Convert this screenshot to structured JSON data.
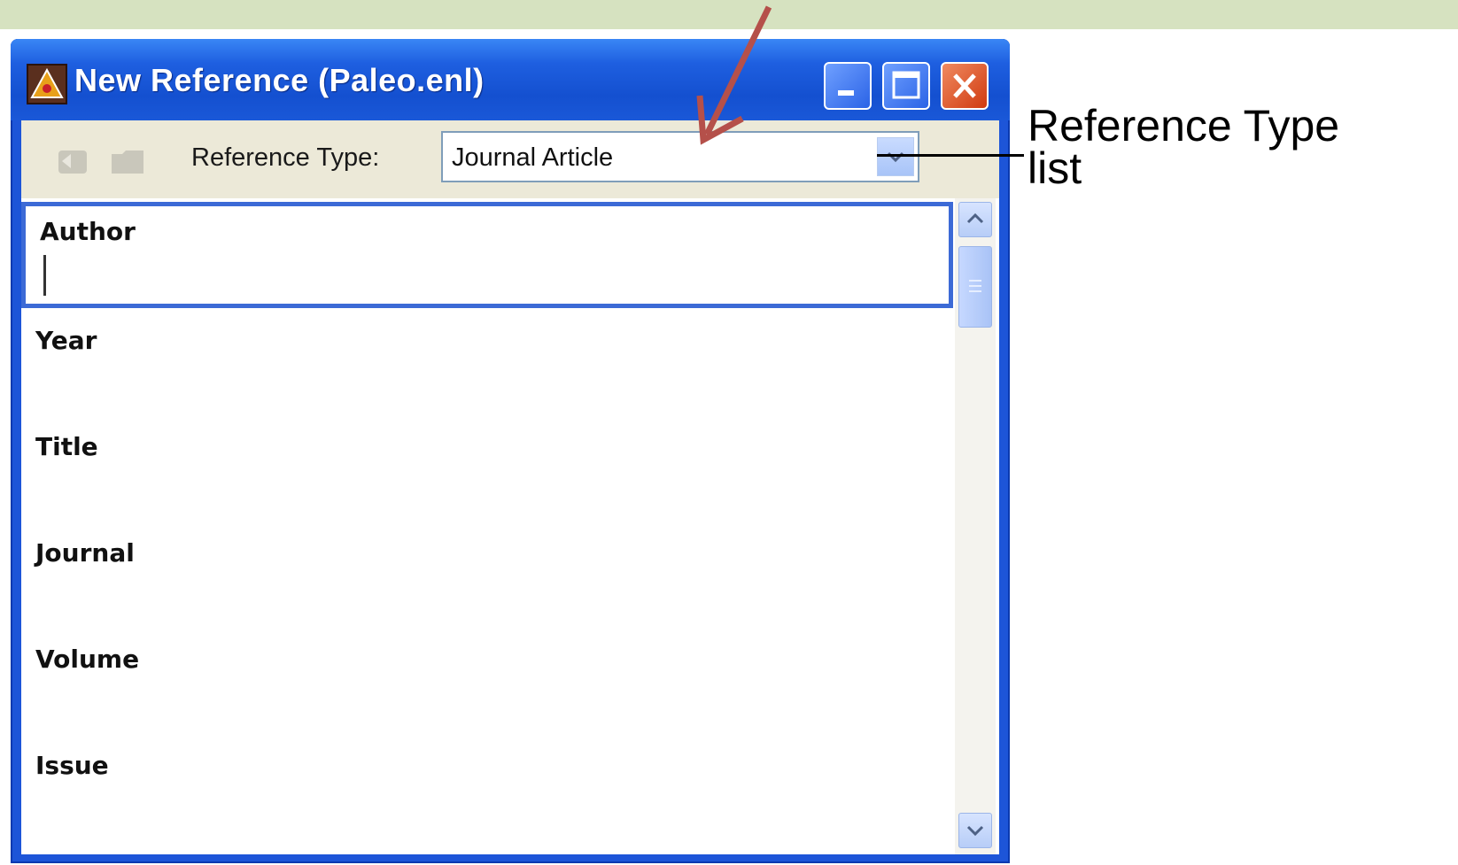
{
  "window": {
    "title": "New Reference (Paleo.enl)",
    "icons": {
      "app": "endnote-app-icon",
      "minimize": "minimize-icon",
      "maximize": "maximize-icon",
      "close": "close-icon"
    }
  },
  "toolbar": {
    "reference_type_label": "Reference Type:",
    "reference_type_value": "Journal Article",
    "icons": [
      "back-icon",
      "folder-icon",
      "chevron-down-icon"
    ]
  },
  "fields": [
    {
      "label": "Author",
      "active": true
    },
    {
      "label": "Year"
    },
    {
      "label": "Title"
    },
    {
      "label": "Journal"
    },
    {
      "label": "Volume"
    },
    {
      "label": "Issue"
    }
  ],
  "annotation": {
    "callout_line1": "Reference Type",
    "callout_line2": "list",
    "arrow_color": "#b5504a"
  },
  "colors": {
    "titlebar": "#1e5fe0",
    "toolbar_bg": "#ece9d8",
    "top_band": "#d6e2c0"
  }
}
